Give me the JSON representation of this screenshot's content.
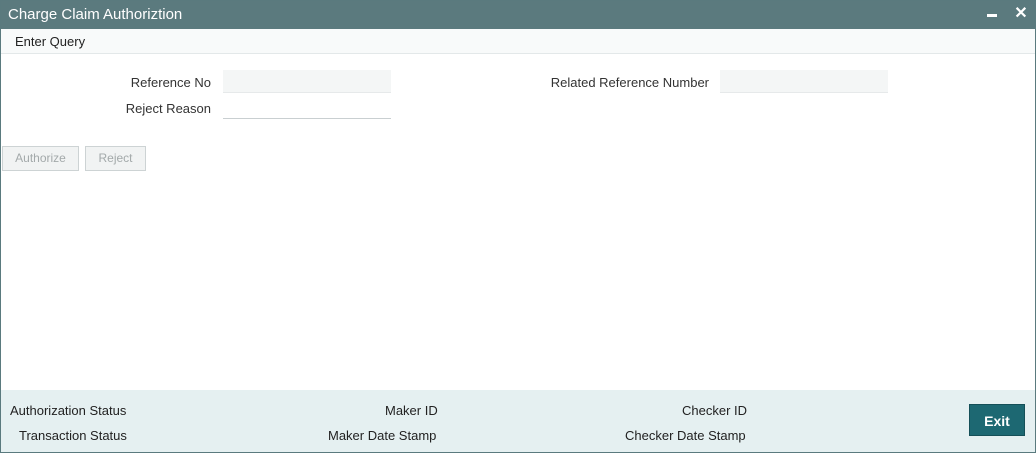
{
  "window": {
    "title": "Charge Claim Authoriztion",
    "minimize_icon": "minimize-icon",
    "close_icon": "close-icon",
    "close_glyph": "✕"
  },
  "menu": {
    "enter_query": "Enter Query"
  },
  "form": {
    "reference_no_label": "Reference No",
    "reference_no_value": "",
    "related_reference_label": "Related Reference Number",
    "related_reference_value": "",
    "reject_reason_label": "Reject Reason",
    "reject_reason_value": ""
  },
  "actions": {
    "authorize": "Authorize",
    "reject": "Reject"
  },
  "footer": {
    "authorization_status": "Authorization Status",
    "transaction_status": "Transaction Status",
    "maker_id": "Maker ID",
    "maker_date_stamp": "Maker Date Stamp",
    "checker_id": "Checker ID",
    "checker_date_stamp": "Checker Date Stamp",
    "exit": "Exit"
  },
  "colors": {
    "titlebar": "#5b7a7e",
    "footer": "#e5f0f1",
    "exit_button": "#1d6872"
  }
}
